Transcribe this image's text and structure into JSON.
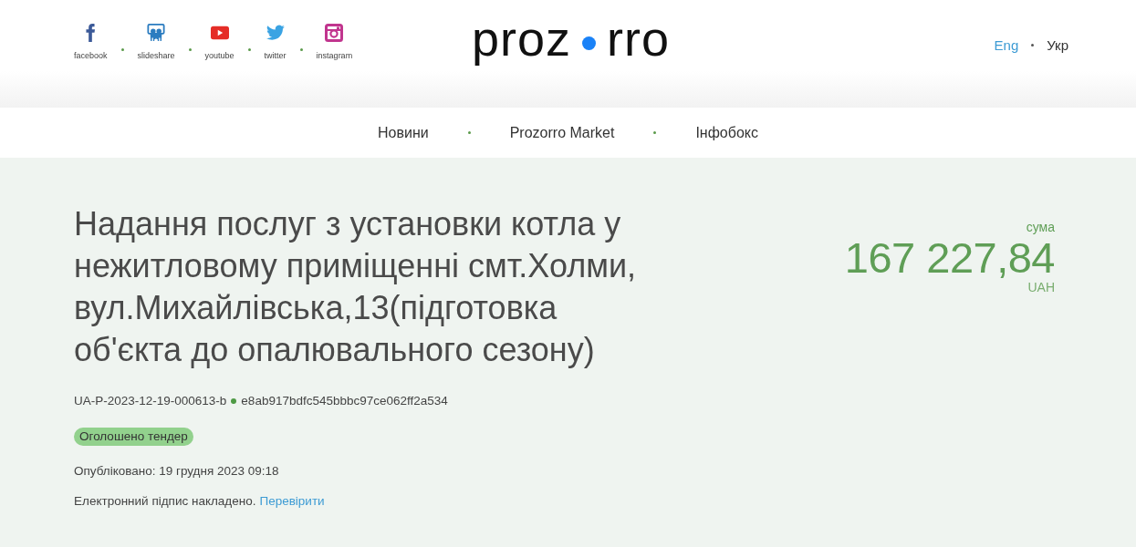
{
  "social_links": [
    {
      "label": "facebook",
      "kind": "facebook"
    },
    {
      "label": "slideshare",
      "kind": "slideshare"
    },
    {
      "label": "youtube",
      "kind": "youtube"
    },
    {
      "label": "twitter",
      "kind": "twitter"
    },
    {
      "label": "instagram",
      "kind": "instagram"
    }
  ],
  "logo": {
    "left": "proz",
    "right": "rro"
  },
  "languages": [
    {
      "label": "Eng",
      "selected": false
    },
    {
      "label": "Укр",
      "selected": true
    }
  ],
  "nav": [
    "Новини",
    "Prozorro Market",
    "Інфобокс"
  ],
  "tender": {
    "title": "Надання послуг з установки котла у нежитловому приміщенні смт.Холми, вул.Михайлівська,13(підготовка об'єкта до опалювального сезону)",
    "tender_id": "UA-P-2023-12-19-000613-b",
    "hash": "e8ab917bdfc545bbbc97ce062ff2a534",
    "status": "Оголошено тендер",
    "published": "Опубліковано: 19 грудня 2023 09:18",
    "signature": "Електронний підпис накладено.",
    "verify_link": "Перевірити"
  },
  "amount": {
    "label": "сума",
    "value": "167 227,84",
    "currency": "UAH"
  }
}
